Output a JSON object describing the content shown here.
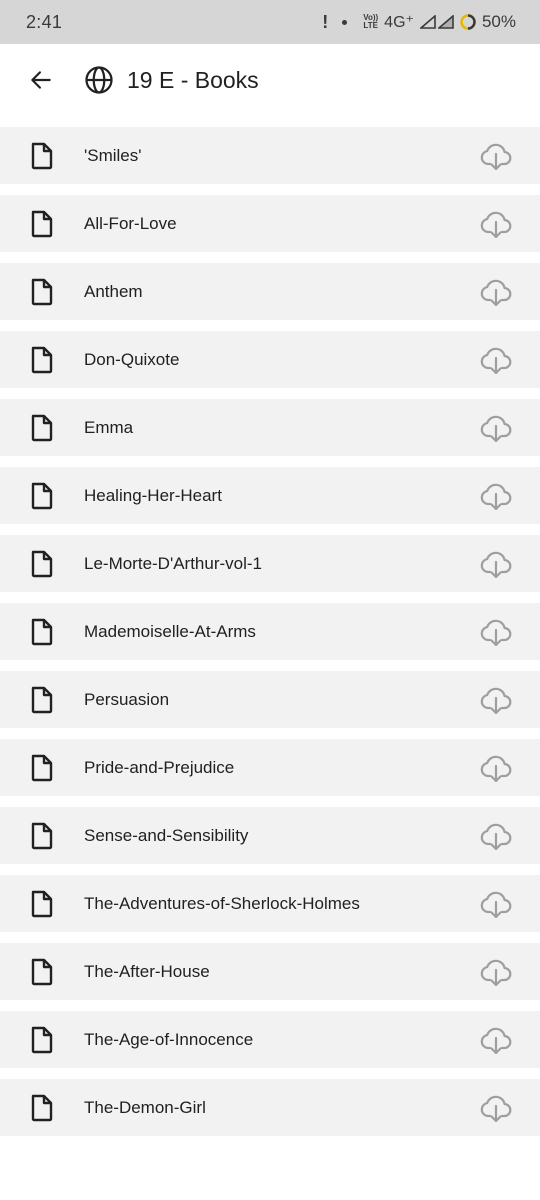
{
  "status_bar": {
    "time": "2:41",
    "alert": "!",
    "volte_top": "Vo))",
    "volte_bottom": "LTE",
    "network": "4G⁺",
    "battery": "50%"
  },
  "app_bar": {
    "title": "19 E - Books"
  },
  "files": [
    {
      "name": "'Smiles'"
    },
    {
      "name": "All-For-Love"
    },
    {
      "name": "Anthem"
    },
    {
      "name": "Don-Quixote"
    },
    {
      "name": "Emma"
    },
    {
      "name": "Healing-Her-Heart"
    },
    {
      "name": "Le-Morte-D'Arthur-vol-1"
    },
    {
      "name": "Mademoiselle-At-Arms"
    },
    {
      "name": "Persuasion"
    },
    {
      "name": "Pride-and-Prejudice"
    },
    {
      "name": "Sense-and-Sensibility"
    },
    {
      "name": "The-Adventures-of-Sherlock-Holmes"
    },
    {
      "name": "The-After-House"
    },
    {
      "name": "The-Age-of-Innocence"
    },
    {
      "name": "The-Demon-Girl"
    }
  ],
  "icons": {
    "back": "arrow-back-icon",
    "globe": "globe-icon",
    "file": "file-icon",
    "download": "cloud-download-icon"
  },
  "colors": {
    "status_bar_bg": "#d6d6d6",
    "row_bg": "#f2f2f2",
    "text": "#212121",
    "download_icon": "#9e9e9e"
  }
}
